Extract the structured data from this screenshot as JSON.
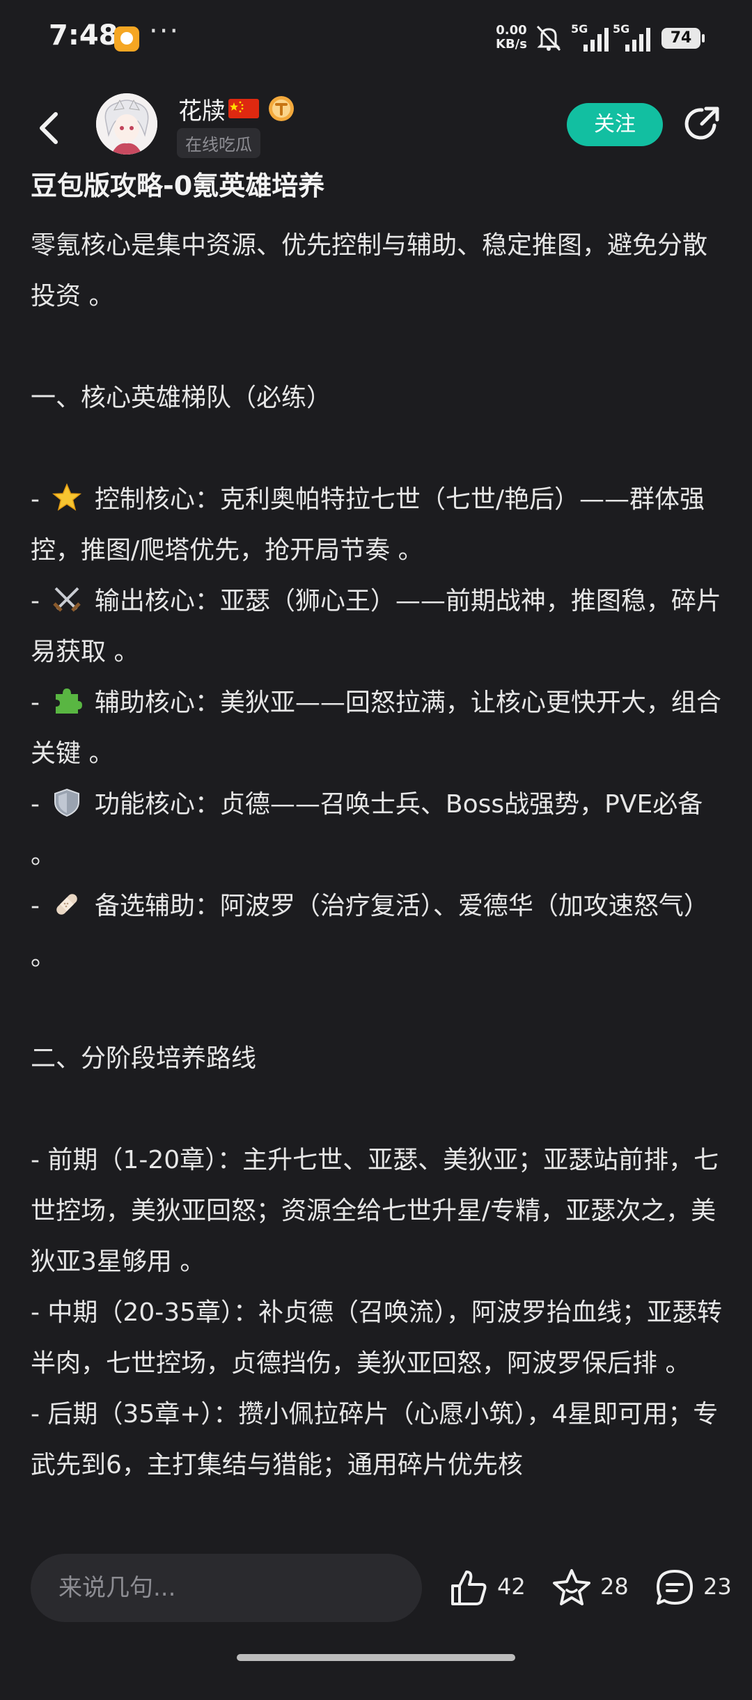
{
  "status": {
    "time": "7:48",
    "dots": "···",
    "net_speed_value": "0.00",
    "net_speed_unit": "KB/s",
    "signal1": "5G",
    "signal2": "5G",
    "battery": "74"
  },
  "header": {
    "username": "花牍",
    "tag": "在线吃瓜",
    "follow_label": "关注"
  },
  "post": {
    "title": "豆包版攻略-0氪英雄培养",
    "intro": "零氪核心是集中资源、优先控制与辅助、稳定推图，避免分散投资 。",
    "section1_heading": "一、核心英雄梯队（必练）",
    "tier": [
      {
        "prefix": "- ",
        "icon": "star-icon",
        "text": " 控制核心：克利奥帕特拉七世（七世/艳后）——群体强控，推图/爬塔优先，抢开局节奏 。"
      },
      {
        "prefix": "- ",
        "icon": "crossed-swords-icon",
        "text": " 输出核心：亚瑟（狮心王）——前期战神，推图稳，碎片易获取 。"
      },
      {
        "prefix": "- ",
        "icon": "puzzle-icon",
        "text": " 辅助核心：美狄亚——回怒拉满，让核心更快开大，组合关键 。"
      },
      {
        "prefix": "- ",
        "icon": "shield-icon",
        "text": " 功能核心：贞德——召唤士兵、Boss战强势，PVE必备 。"
      },
      {
        "prefix": "- ",
        "icon": "bandage-icon",
        "text": " 备选辅助：阿波罗（治疗复活）、爱德华（加攻速怒气） 。"
      }
    ],
    "section2_heading": "二、分阶段培养路线",
    "stages": [
      "- 前期（1-20章）：主升七世、亚瑟、美狄亚；亚瑟站前排，七世控场，美狄亚回怒；资源全给七世升星/专精，亚瑟次之，美狄亚3星够用 。",
      "- 中期（20-35章）：补贞德（召唤流），阿波罗抬血线；亚瑟转半肉，七世控场，贞德挡伤，美狄亚回怒，阿波罗保后排 。",
      "- 后期（35章+）：攒小佩拉碎片（心愿小筑），4星即可用；专武先到6，主打集结与猎能；通用碎片优先核"
    ]
  },
  "bottom": {
    "comment_placeholder": "来说几句...",
    "likes": "42",
    "favorites": "28",
    "comments": "23"
  },
  "colors": {
    "background": "#1c1c1f",
    "accent": "#12bfa1",
    "text": "#ececec"
  }
}
